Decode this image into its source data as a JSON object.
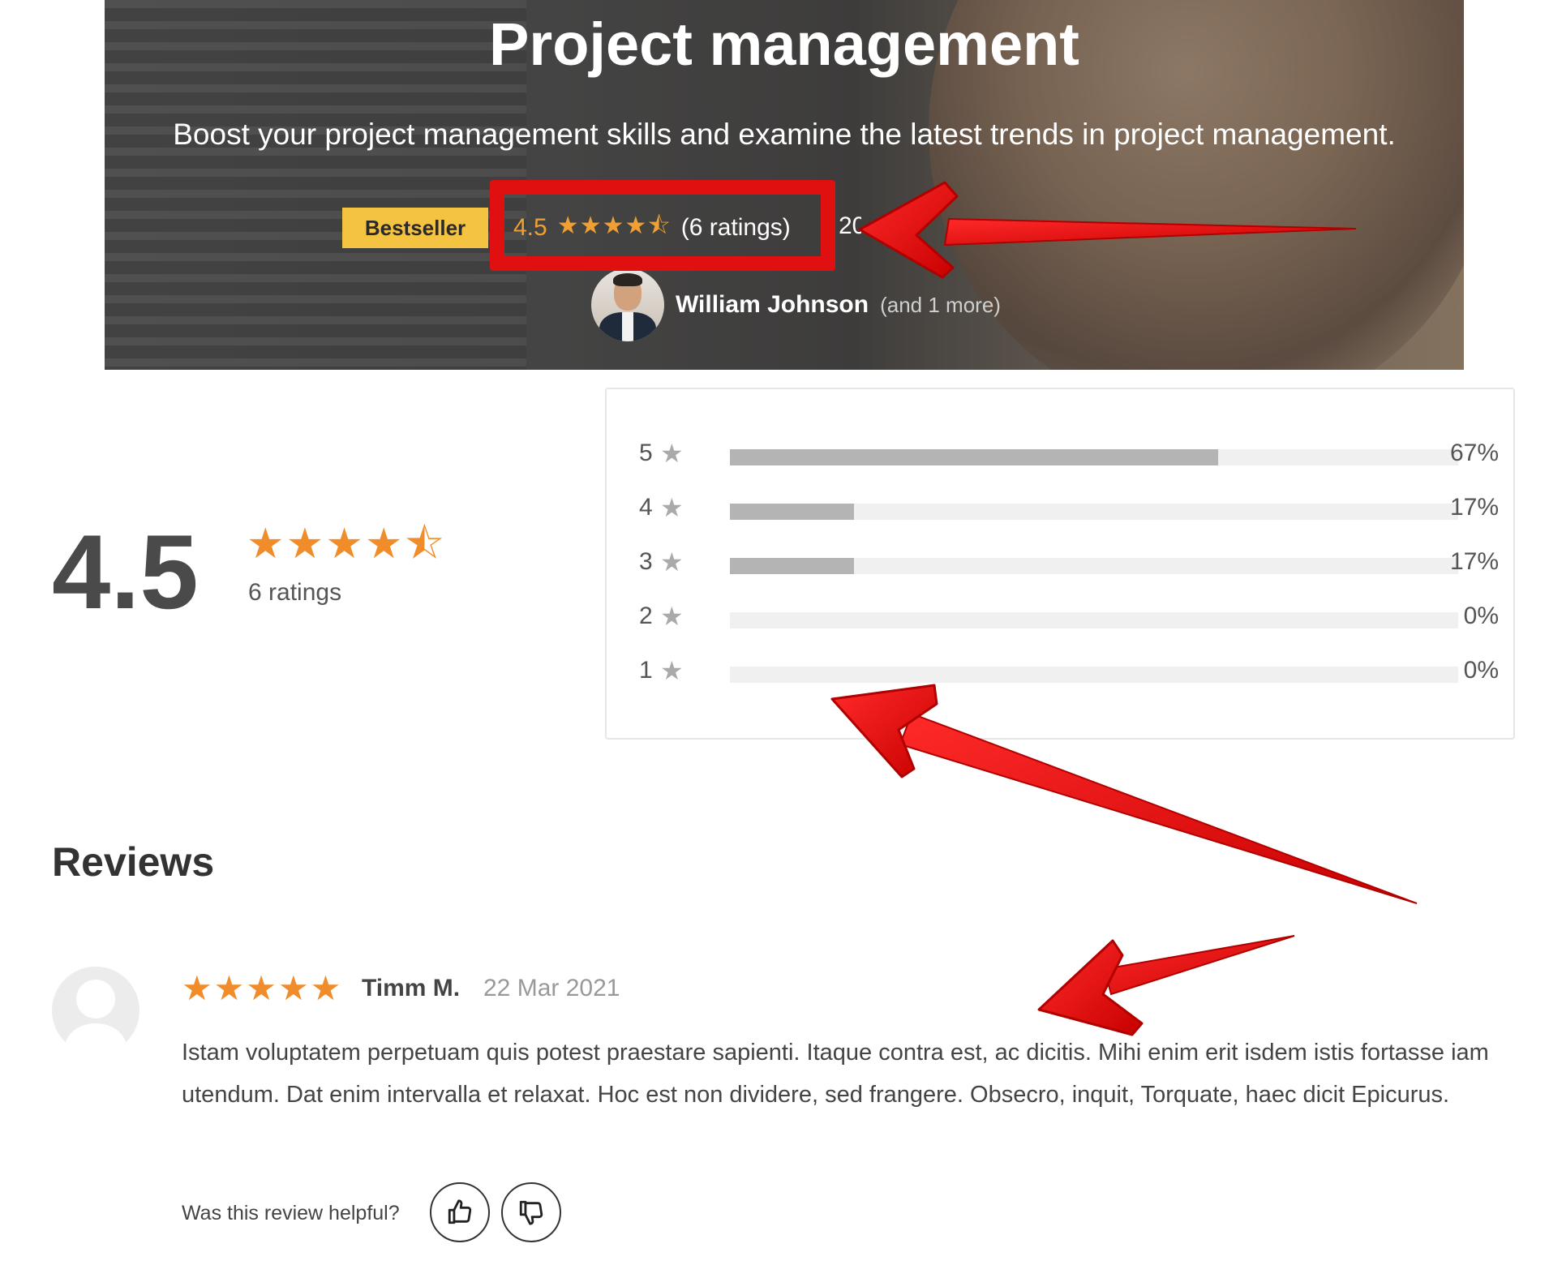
{
  "hero": {
    "title": "Project management",
    "subtitle": "Boost your project management skills and examine the latest trends in project management.",
    "badge": "Bestseller",
    "rating": "4.5",
    "stars": "★★★★⯪",
    "ratings_count": "(6 ratings)",
    "extra_text": "20",
    "instructor_name": "William Johnson",
    "instructor_more": "(and 1 more)"
  },
  "summary": {
    "score": "4.5",
    "stars": "★★★★⯪",
    "ratings_label": "6 ratings"
  },
  "distribution": [
    {
      "level": "5",
      "percent_label": "67%",
      "fraction": 0.67
    },
    {
      "level": "4",
      "percent_label": "17%",
      "fraction": 0.17
    },
    {
      "level": "3",
      "percent_label": "17%",
      "fraction": 0.17
    },
    {
      "level": "2",
      "percent_label": "0%",
      "fraction": 0.0
    },
    {
      "level": "1",
      "percent_label": "0%",
      "fraction": 0.0
    }
  ],
  "reviews": {
    "title": "Reviews",
    "items": [
      {
        "stars": "★★★★★",
        "author": "Timm M.",
        "date": "22 Mar 2021",
        "text": "Istam voluptatem perpetuam quis potest praestare sapienti. Itaque contra est, ac dicitis. Mihi enim erit isdem istis fortasse iam utendum. Dat enim intervalla et relaxat. Hoc est non dividere, sed frangere. Obsecro, inquit, Torquate, haec dicit Epicurus.",
        "helpful_label": "Was this review helpful?"
      }
    ]
  },
  "colors": {
    "star": "#f08c2a",
    "badge": "#f5c342",
    "annotation": "#e01010",
    "bar_fill": "#b4b4b4",
    "bar_track": "#f0f0f0"
  },
  "icons": {
    "upvote": "thumbs-up-icon",
    "downvote": "thumbs-down-icon",
    "level_star": "star-icon"
  }
}
